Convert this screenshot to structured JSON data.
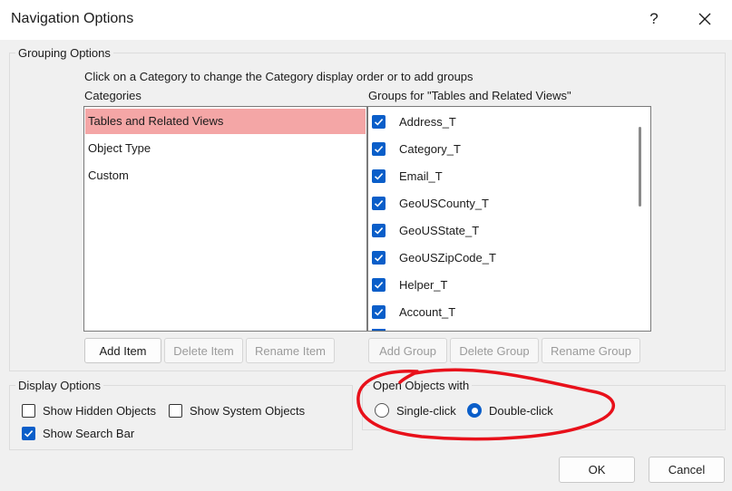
{
  "window": {
    "title": "Navigation Options",
    "help_glyph": "?",
    "close_icon": "close-icon"
  },
  "grouping": {
    "label": "Grouping Options",
    "instructions": "Click on a Category to change the Category display order or to add groups",
    "categories_header": "Categories",
    "groups_header": "Groups for \"Tables and Related Views\"",
    "categories": [
      {
        "label": "Tables and Related Views",
        "selected": true
      },
      {
        "label": "Object Type",
        "selected": false
      },
      {
        "label": "Custom",
        "selected": false
      }
    ],
    "groups": [
      {
        "label": "Address_T",
        "checked": true
      },
      {
        "label": "Category_T",
        "checked": true
      },
      {
        "label": "Email_T",
        "checked": true
      },
      {
        "label": "GeoUSCounty_T",
        "checked": true
      },
      {
        "label": "GeoUSState_T",
        "checked": true
      },
      {
        "label": "GeoUSZipCode_T",
        "checked": true
      },
      {
        "label": "Helper_T",
        "checked": true
      },
      {
        "label": "Account_T",
        "checked": true
      }
    ],
    "category_buttons": {
      "add_item": "Add Item",
      "delete_item": "Delete Item",
      "rename_item": "Rename Item"
    },
    "group_buttons": {
      "add_group": "Add Group",
      "delete_group": "Delete Group",
      "rename_group": "Rename Group"
    }
  },
  "display_options": {
    "label": "Display Options",
    "show_hidden_objects": {
      "label": "Show Hidden Objects",
      "checked": false
    },
    "show_system_objects": {
      "label": "Show System Objects",
      "checked": false
    },
    "show_search_bar": {
      "label": "Show Search Bar",
      "checked": true
    }
  },
  "open_objects": {
    "label": "Open Objects with",
    "single_click": {
      "label": "Single-click",
      "selected": false
    },
    "double_click": {
      "label": "Double-click",
      "selected": true
    }
  },
  "footer": {
    "ok": "OK",
    "cancel": "Cancel"
  },
  "colors": {
    "selected_category": "#f4a6a6",
    "accent": "#0a5ec9",
    "annotation": "#e8101a"
  }
}
